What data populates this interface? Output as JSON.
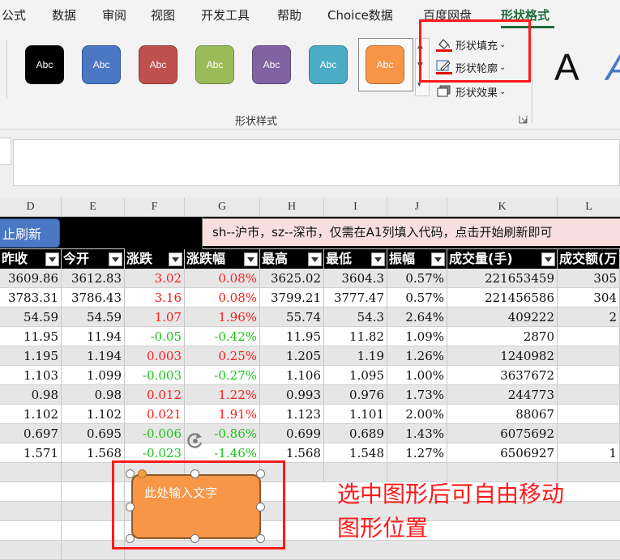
{
  "ribbon": {
    "tabs": [
      "公式",
      "数据",
      "审阅",
      "视图",
      "开发工具",
      "帮助",
      "Choice数据",
      "百度网盘",
      "形状格式"
    ],
    "active_tab": "形状格式",
    "style_swatches": [
      {
        "label": "Abc",
        "color": "#000000"
      },
      {
        "label": "Abc",
        "color": "#4a78c4"
      },
      {
        "label": "Abc",
        "color": "#c0504d"
      },
      {
        "label": "Abc",
        "color": "#9bbb59"
      },
      {
        "label": "Abc",
        "color": "#8064a2"
      },
      {
        "label": "Abc",
        "color": "#4bacc6"
      },
      {
        "label": "Abc",
        "color": "#f79646"
      }
    ],
    "commands": {
      "fill": "形状填充",
      "outline": "形状轮廓",
      "effect": "形状效果"
    },
    "group_label": "形状样式",
    "wordart_letter": "A"
  },
  "sheet": {
    "columns": [
      "D",
      "E",
      "F",
      "G",
      "H",
      "I",
      "J",
      "K",
      "L"
    ],
    "refresh_button": "止刷新",
    "banner": "sh--沪市，sz--深市，仅需在A1列填入代码，点击开始刷新即可",
    "headers": [
      "昨收",
      "今开",
      "涨跌",
      "涨跌幅",
      "最高",
      "最低",
      "振幅",
      "成交量(手)",
      "成交额(万"
    ],
    "rows": [
      {
        "zs": "3609.86",
        "jk": "3612.83",
        "zd": "3.02",
        "zdf": "0.08%",
        "zg": "3625.02",
        "zd2": "3604.3",
        "zf": "0.57%",
        "cjl": "221653459",
        "cje": "305",
        "dir": "up"
      },
      {
        "zs": "3783.31",
        "jk": "3786.43",
        "zd": "3.16",
        "zdf": "0.08%",
        "zg": "3799.21",
        "zd2": "3777.47",
        "zf": "0.57%",
        "cjl": "221456586",
        "cje": "304",
        "dir": "up"
      },
      {
        "zs": "54.59",
        "jk": "54.59",
        "zd": "1.07",
        "zdf": "1.96%",
        "zg": "55.74",
        "zd2": "54.3",
        "zf": "2.64%",
        "cjl": "409222",
        "cje": "2",
        "dir": "up"
      },
      {
        "zs": "11.95",
        "jk": "11.94",
        "zd": "-0.05",
        "zdf": "-0.42%",
        "zg": "11.95",
        "zd2": "11.82",
        "zf": "1.09%",
        "cjl": "2870",
        "cje": "",
        "dir": "down"
      },
      {
        "zs": "1.195",
        "jk": "1.194",
        "zd": "0.003",
        "zdf": "0.25%",
        "zg": "1.205",
        "zd2": "1.19",
        "zf": "1.26%",
        "cjl": "1240982",
        "cje": "",
        "dir": "up"
      },
      {
        "zs": "1.103",
        "jk": "1.099",
        "zd": "-0.003",
        "zdf": "-0.27%",
        "zg": "1.106",
        "zd2": "1.095",
        "zf": "1.00%",
        "cjl": "3637672",
        "cje": "",
        "dir": "down"
      },
      {
        "zs": "0.98",
        "jk": "0.98",
        "zd": "0.012",
        "zdf": "1.22%",
        "zg": "0.993",
        "zd2": "0.976",
        "zf": "1.73%",
        "cjl": "244773",
        "cje": "",
        "dir": "up"
      },
      {
        "zs": "1.102",
        "jk": "1.102",
        "zd": "0.021",
        "zdf": "1.91%",
        "zg": "1.123",
        "zd2": "1.101",
        "zf": "2.00%",
        "cjl": "88067",
        "cje": "",
        "dir": "up"
      },
      {
        "zs": "0.697",
        "jk": "0.695",
        "zd": "-0.006",
        "zdf": "-0.86%",
        "zg": "0.699",
        "zd2": "0.689",
        "zf": "1.43%",
        "cjl": "6075692",
        "cje": "",
        "dir": "down"
      },
      {
        "zs": "1.571",
        "jk": "1.568",
        "zd": "-0.023",
        "zdf": "-1.46%",
        "zg": "1.568",
        "zd2": "1.548",
        "zf": "1.27%",
        "cjl": "6506927",
        "cje": "1",
        "dir": "down"
      }
    ]
  },
  "shape": {
    "text": "此处输入文字",
    "fill": "#f79646"
  },
  "annotation": {
    "line1": "选中图形后可自由移动",
    "line2": "图形位置"
  },
  "colors": {
    "up": "#ff1a1a",
    "down": "#19c419",
    "highlight": "#ff1a1a"
  }
}
